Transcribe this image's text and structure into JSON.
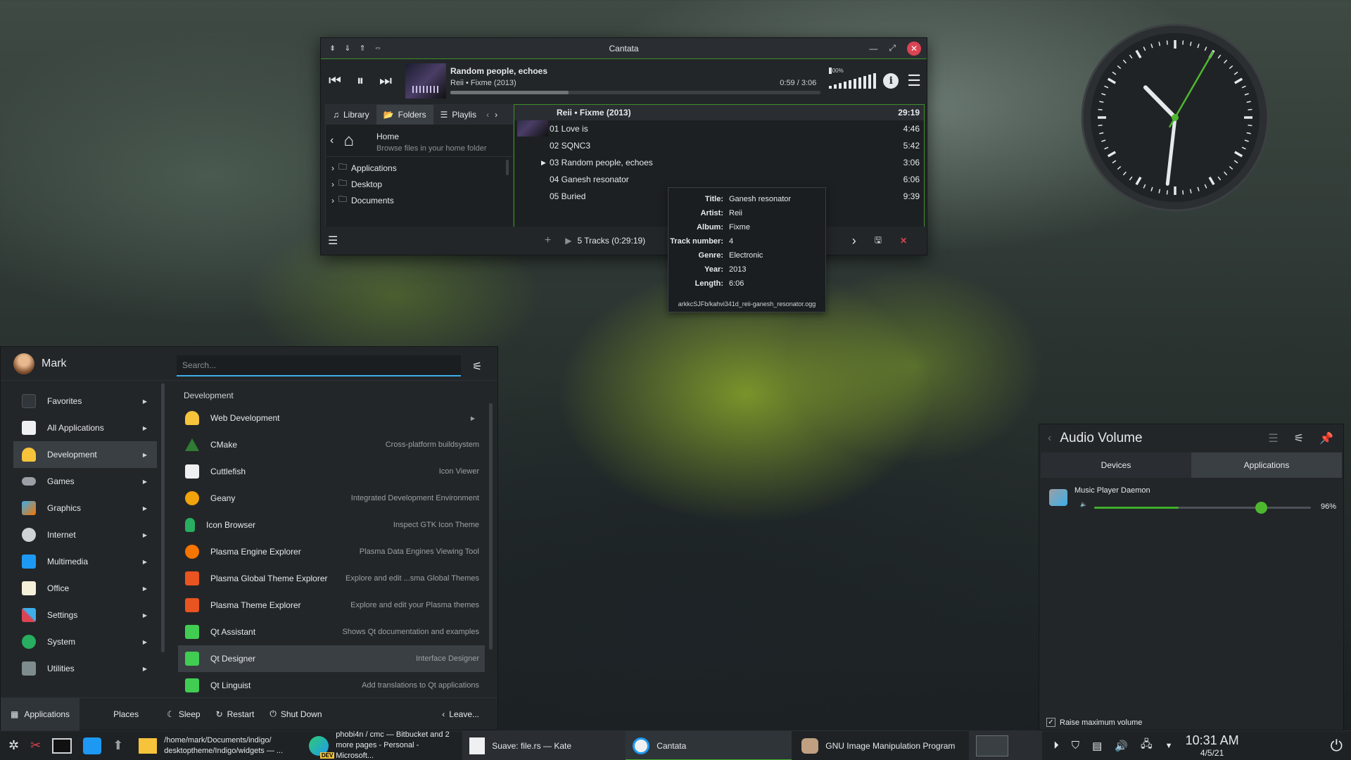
{
  "cantata": {
    "title": "Cantata",
    "player": {
      "track_title": "Random people, echoes",
      "track_sub": "Reii • Fixme (2013)",
      "time": "0:59 / 3:06",
      "progress": 0.32,
      "volume_label": "100%"
    },
    "tabs": [
      "Library",
      "Folders",
      "Playlis"
    ],
    "home": {
      "title": "Home",
      "subtitle": "Browse files in your home folder"
    },
    "folders": [
      "Applications",
      "Desktop",
      "Documents"
    ],
    "album_header": {
      "title": "Reii • Fixme (2013)",
      "duration": "29:19"
    },
    "tracks": [
      {
        "title": "01 Love is",
        "duration": "4:46"
      },
      {
        "title": "02 SQNC3",
        "duration": "5:42"
      },
      {
        "title": "03 Random people, echoes",
        "duration": "3:06"
      },
      {
        "title": "04 Ganesh resonator",
        "duration": "6:06"
      },
      {
        "title": "05 Buried",
        "duration": "9:39"
      }
    ],
    "status": "5 Tracks (0:29:19)"
  },
  "tooltip": {
    "rows": [
      {
        "k": "Title:",
        "v": "Ganesh resonator"
      },
      {
        "k": "Artist:",
        "v": "Reii"
      },
      {
        "k": "Album:",
        "v": "Fixme"
      },
      {
        "k": "Track number:",
        "v": "4"
      },
      {
        "k": "Genre:",
        "v": "Electronic"
      },
      {
        "k": "Year:",
        "v": "2013"
      },
      {
        "k": "Length:",
        "v": "6:06"
      }
    ],
    "file": "arkkcSJFb/kahvi341d_reii-ganesh_resonator.ogg"
  },
  "launcher": {
    "user": "Mark",
    "search_placeholder": "Search...",
    "categories": [
      {
        "label": "Favorites",
        "icon": "bookmark-icon",
        "color": "#31363b"
      },
      {
        "label": "All Applications",
        "icon": "document-icon",
        "color": "#eff0f1"
      },
      {
        "label": "Development",
        "icon": "hardhat-icon",
        "color": "#f6c33b"
      },
      {
        "label": "Games",
        "icon": "gamepad-icon",
        "color": "#9aa0a5"
      },
      {
        "label": "Graphics",
        "icon": "graphics-icon",
        "color": "#3daee9"
      },
      {
        "label": "Internet",
        "icon": "globe-icon",
        "color": "#cfd3d6"
      },
      {
        "label": "Multimedia",
        "icon": "clapper-icon",
        "color": "#1d99f3"
      },
      {
        "label": "Office",
        "icon": "office-icon",
        "color": "#f5f0d8"
      },
      {
        "label": "Settings",
        "icon": "tools-icon",
        "color": "#da4453"
      },
      {
        "label": "System",
        "icon": "gear-icon",
        "color": "#27ae60"
      },
      {
        "label": "Utilities",
        "icon": "utilities-icon",
        "color": "#7f8c8d"
      }
    ],
    "category_header": "Development",
    "apps": [
      {
        "name": "Web Development",
        "desc": "",
        "icon": "hardhat-icon",
        "color": "#f6c33b"
      },
      {
        "name": "CMake",
        "desc": "Cross-platform buildsystem",
        "icon": "cmake-icon",
        "color": "#2e7d32"
      },
      {
        "name": "Cuttlefish",
        "desc": "Icon Viewer",
        "icon": "document-icon",
        "color": "#eff0f1"
      },
      {
        "name": "Geany",
        "desc": "Integrated Development Environment",
        "icon": "geany-icon",
        "color": "#f0a30a"
      },
      {
        "name": "Icon Browser",
        "desc": "Inspect GTK Icon Theme",
        "icon": "bottle-icon",
        "color": "#27ae60"
      },
      {
        "name": "Plasma Engine Explorer",
        "desc": "Plasma Data Engines Viewing Tool",
        "icon": "plasma-icon",
        "color": "#f67400"
      },
      {
        "name": "Plasma Global Theme Explorer",
        "desc": "Explore and edit ...sma Global Themes",
        "icon": "theme-icon",
        "color": "#e95420"
      },
      {
        "name": "Plasma Theme Explorer",
        "desc": "Explore and edit your Plasma themes",
        "icon": "theme-icon",
        "color": "#e95420"
      },
      {
        "name": "Qt Assistant",
        "desc": "Shows Qt documentation and examples",
        "icon": "qt-icon",
        "color": "#41cd52"
      },
      {
        "name": "Qt Designer",
        "desc": "Interface Designer",
        "icon": "qt-icon",
        "color": "#41cd52"
      },
      {
        "name": "Qt Linguist",
        "desc": "Add translations to Qt applications",
        "icon": "qt-icon",
        "color": "#41cd52"
      }
    ],
    "footer": {
      "applications": "Applications",
      "places": "Places",
      "sleep": "Sleep",
      "restart": "Restart",
      "shutdown": "Shut Down",
      "leave": "Leave..."
    }
  },
  "audio": {
    "title": "Audio Volume",
    "tabs": [
      "Devices",
      "Applications"
    ],
    "device": {
      "name": "Music Player Daemon",
      "value": 96,
      "percent": "96%"
    },
    "raise_max": "Raise maximum volume"
  },
  "taskbar": {
    "tasks": [
      {
        "line1": "/home/mark/Documents/indigo/",
        "line2": "desktoptheme/Indigo/widgets — ..."
      },
      {
        "line1": "phobi4n / cmc — Bitbucket and 2",
        "line2": "more pages - Personal - Microsoft..."
      },
      {
        "line1": "Suave: file.rs — Kate",
        "line2": ""
      },
      {
        "line1": "Cantata",
        "line2": ""
      },
      {
        "line1": "GNU Image Manipulation Program",
        "line2": ""
      }
    ],
    "time": "10:31 AM",
    "date": "4/5/21",
    "dev_badge": "DEV"
  },
  "clock": {
    "hours": 10,
    "minutes": 31,
    "seconds": 5
  }
}
